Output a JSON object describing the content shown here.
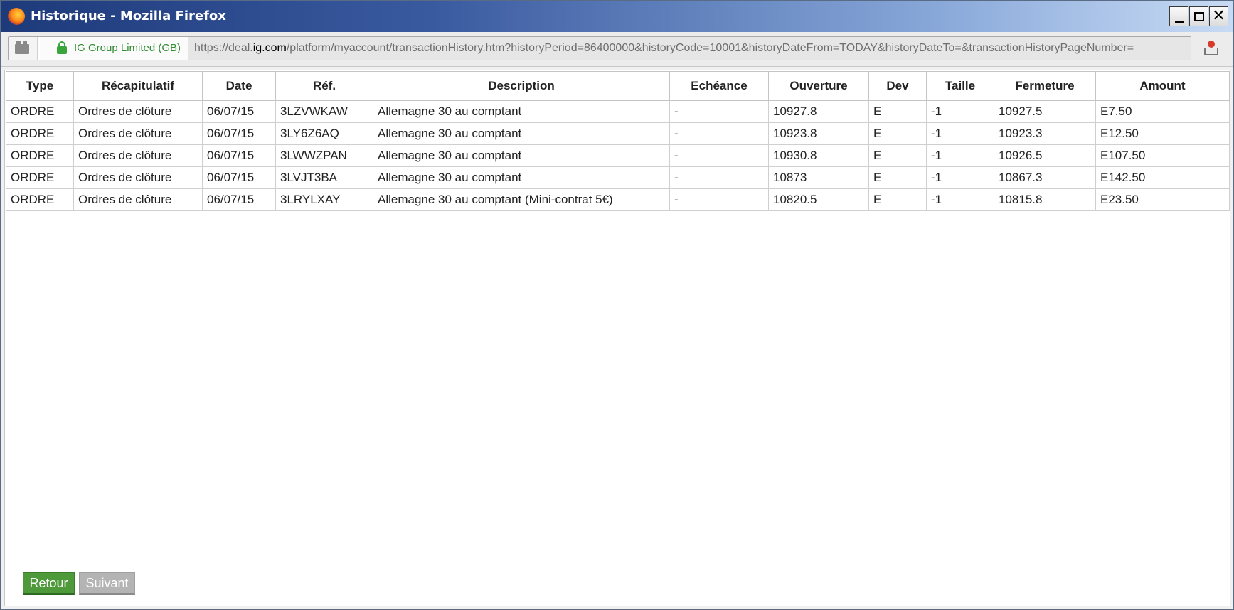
{
  "window": {
    "title": "Historique - Mozilla Firefox",
    "close_glyph": "✕"
  },
  "navbar": {
    "identity_label": "IG Group Limited (GB)",
    "url_prefix": "https://deal.",
    "url_domain": "ig.com",
    "url_rest": "/platform/myaccount/transactionHistory.htm?historyPeriod=86400000&historyCode=10001&historyDateFrom=TODAY&historyDateTo=&transactionHistoryPageNumber="
  },
  "table": {
    "headers": [
      "Type",
      "Récapitulatif",
      "Date",
      "Réf.",
      "Description",
      "Echéance",
      "Ouverture",
      "Dev",
      "Taille",
      "Fermeture",
      "Amount"
    ],
    "rows": [
      [
        "ORDRE",
        "Ordres de clôture",
        "06/07/15",
        "3LZVWKAW",
        "Allemagne 30 au comptant",
        "-",
        "10927.8",
        "E",
        "-1",
        "10927.5",
        "E7.50"
      ],
      [
        "ORDRE",
        "Ordres de clôture",
        "06/07/15",
        "3LY6Z6AQ",
        "Allemagne 30 au comptant",
        "-",
        "10923.8",
        "E",
        "-1",
        "10923.3",
        "E12.50"
      ],
      [
        "ORDRE",
        "Ordres de clôture",
        "06/07/15",
        "3LWWZPAN",
        "Allemagne 30 au comptant",
        "-",
        "10930.8",
        "E",
        "-1",
        "10926.5",
        "E107.50"
      ],
      [
        "ORDRE",
        "Ordres de clôture",
        "06/07/15",
        "3LVJT3BA",
        "Allemagne 30 au comptant",
        "-",
        "10873",
        "E",
        "-1",
        "10867.3",
        "E142.50"
      ],
      [
        "ORDRE",
        "Ordres de clôture",
        "06/07/15",
        "3LRYLXAY",
        "Allemagne 30 au comptant (Mini-contrat 5€)",
        "-",
        "10820.5",
        "E",
        "-1",
        "10815.8",
        "E23.50"
      ]
    ]
  },
  "buttons": {
    "back_label": "Retour",
    "next_label": "Suivant"
  },
  "colors": {
    "back_button": "#4e9a3a",
    "next_button_disabled": "#b4b4b4",
    "secure_text": "#2f8c2f"
  }
}
